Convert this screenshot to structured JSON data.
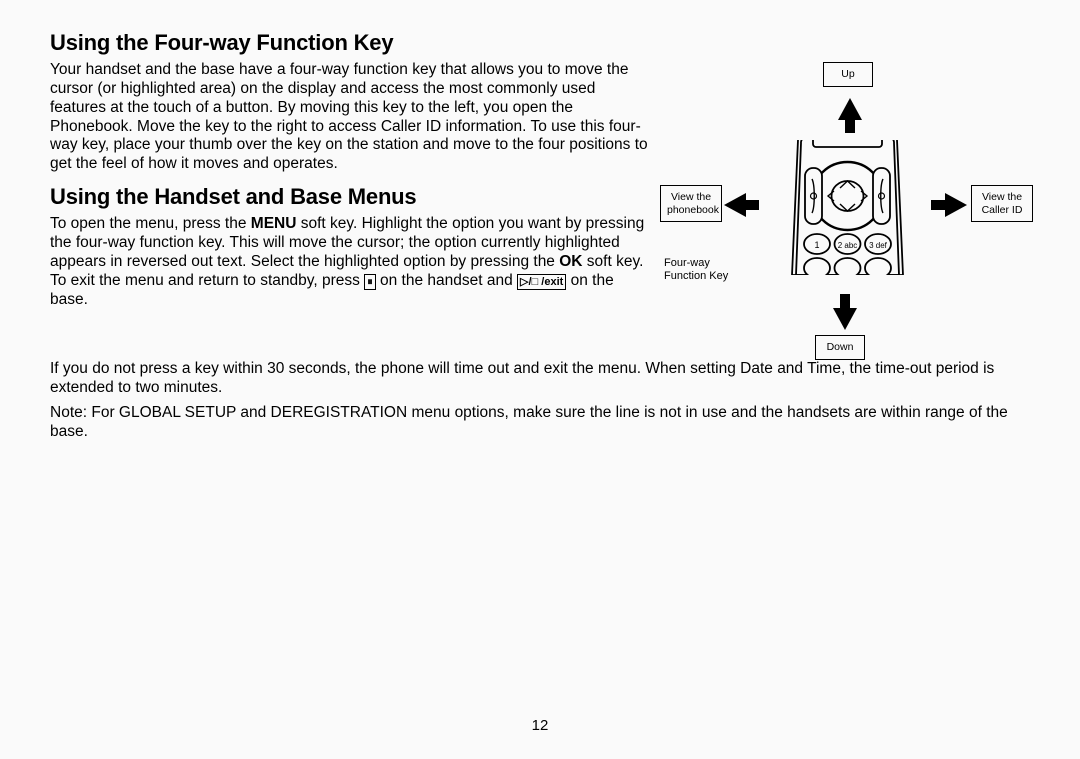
{
  "section1": {
    "heading": "Using the Four-way Function Key",
    "p1": "Your handset and the base have a four-way function key that allows you to move the cursor (or highlighted area) on the display and access the most commonly used features at the touch of a button. By moving this key to the left, you open the Phonebook. Move the key to the right to access Caller ID information. To use this four-way key, place your thumb over the key on the station and move to the four positions to get the feel of how it moves and operates."
  },
  "section2": {
    "heading": "Using the Handset and Base Menus",
    "p1a": "To open the menu, press the ",
    "p1b": " soft key. Highlight the option you want by pressing the four-way function key. This will move the cursor; the option currently highlighted appears in reversed out text. Select the highlighted option by pressing the ",
    "p1c": " soft key. To exit the menu and return to standby, press ",
    "p1d": " on the handset and ",
    "p1e": " on the base.",
    "menu_key": "MENU",
    "ok_key": "OK",
    "exit_key": "/exit",
    "icon1_glyph": "⏸",
    "icon2_glyph": "▷/□",
    "p2": "If you do not press a key within 30 seconds, the phone will time out and exit the menu. When setting Date and Time, the time-out period is extended to two minutes.",
    "p3": "Note: For GLOBAL SETUP and DEREGISTRATION menu options, make sure the line is not in use and the handsets are within range of the base."
  },
  "figure": {
    "up": "Up",
    "down": "Down",
    "left": "View the phonebook",
    "right": "View the Caller ID",
    "caption": "Four-way\nFunction Key"
  },
  "page_number": "12"
}
